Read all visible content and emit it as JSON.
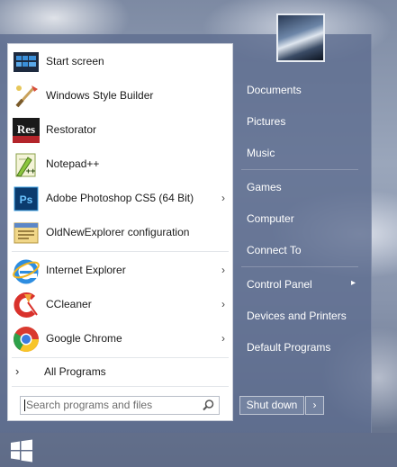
{
  "start_menu": {
    "programs": [
      {
        "label": "Start screen",
        "icon": "start-screen-icon",
        "has_submenu": false
      },
      {
        "label": "Windows Style Builder",
        "icon": "brush-icon",
        "has_submenu": false
      },
      {
        "label": "Restorator",
        "icon": "restorator-icon",
        "has_submenu": false
      },
      {
        "label": "Notepad++",
        "icon": "notepadpp-icon",
        "has_submenu": false
      },
      {
        "label": "Adobe Photoshop CS5 (64 Bit)",
        "icon": "photoshop-icon",
        "has_submenu": true
      },
      {
        "label": "OldNewExplorer configuration",
        "icon": "explorer-config-icon",
        "has_submenu": false
      },
      {
        "label": "Internet Explorer",
        "icon": "internet-explorer-icon",
        "has_submenu": true
      },
      {
        "label": "CCleaner",
        "icon": "ccleaner-icon",
        "has_submenu": true
      },
      {
        "label": "Google Chrome",
        "icon": "chrome-icon",
        "has_submenu": true
      }
    ],
    "all_programs_label": "All Programs",
    "search_placeholder": "Search programs and files",
    "right_items": [
      {
        "label": "Documents"
      },
      {
        "label": "Pictures"
      },
      {
        "label": "Music"
      },
      {
        "label": "Games"
      },
      {
        "label": "Computer"
      },
      {
        "label": "Connect To"
      },
      {
        "label": "Control Panel",
        "has_submenu": true
      },
      {
        "label": "Devices and Printers"
      },
      {
        "label": "Default Programs"
      }
    ],
    "shutdown_label": "Shut down",
    "submenu_glyph": "›",
    "panel_arrow_glyph": "▸",
    "all_programs_glyph": "›",
    "shutdown_arrow_glyph": "›",
    "icon_texts": {
      "restorator": "Res",
      "photoshop": "Ps",
      "notepadpp": "++"
    }
  }
}
